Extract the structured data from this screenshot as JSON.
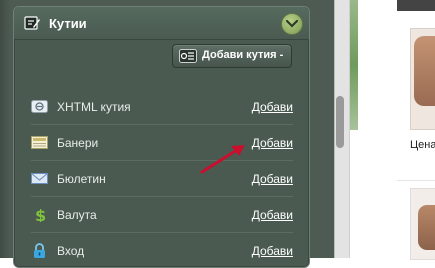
{
  "widget": {
    "title": "Кутии",
    "add_widget_label": "Добави кутия -"
  },
  "items": [
    {
      "name": "XHTML кутия",
      "action": "Добави",
      "icon": "xhtml-icon"
    },
    {
      "name": "Банери",
      "action": "Добави",
      "icon": "banner-icon"
    },
    {
      "name": "Бюлетин",
      "action": "Добави",
      "icon": "mail-icon"
    },
    {
      "name": "Валута",
      "action": "Добави",
      "icon": "dollar-icon"
    },
    {
      "name": "Вход",
      "action": "Добави",
      "icon": "lock-icon"
    }
  ],
  "right_panel": {
    "price_label": "Цена"
  },
  "colors": {
    "panel_bg": "#4d5b52",
    "accent_green": "#8aa85e",
    "arrow_red": "#c8102e"
  }
}
